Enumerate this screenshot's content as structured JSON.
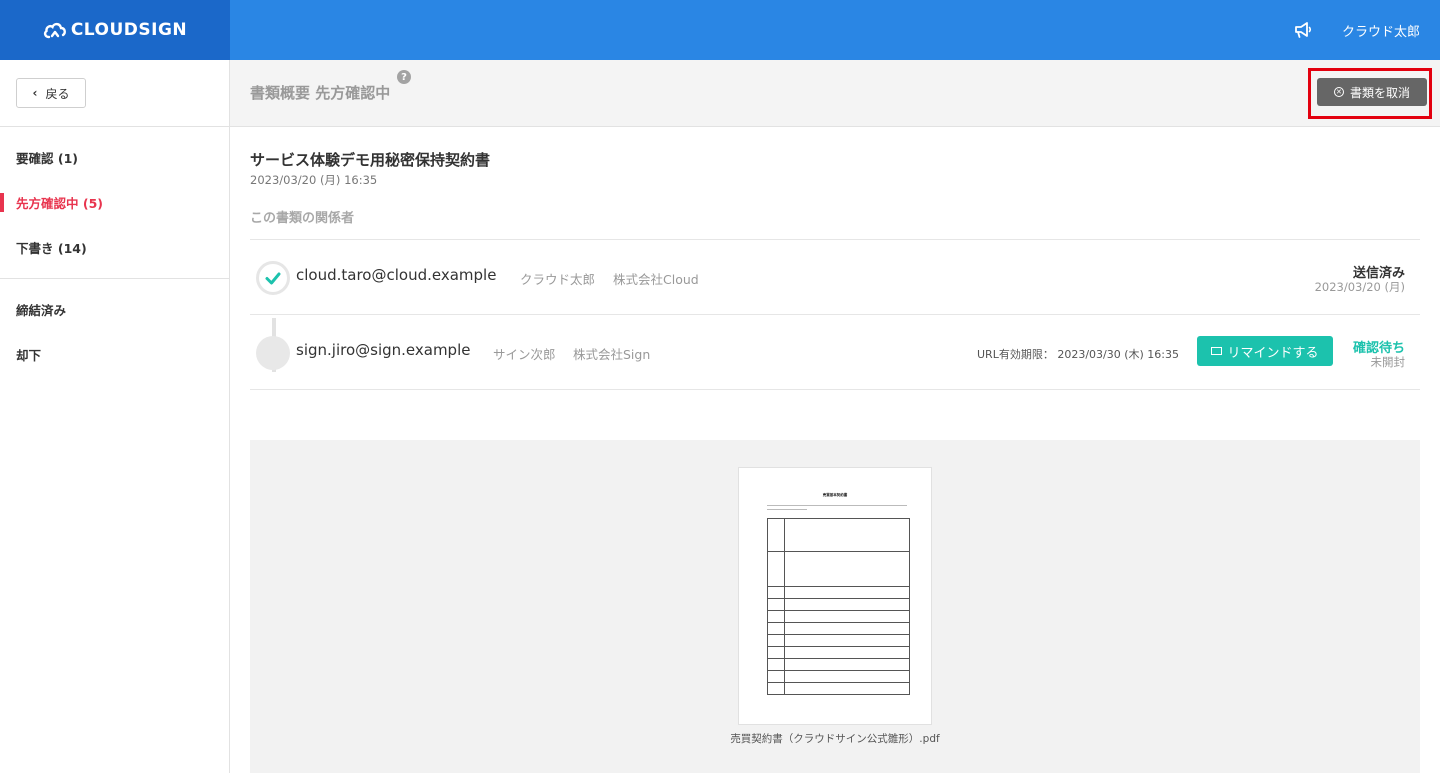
{
  "header": {
    "logo_text": "CLOUDSIGN",
    "logo_icon": "cloud-icon",
    "notification_icon": "megaphone-icon",
    "user_name": "クラウド太郎"
  },
  "sidebar": {
    "back_label": "戻る",
    "items": [
      {
        "label": "要確認 (1)",
        "active": false
      },
      {
        "label": "先方確認中 (5)",
        "active": true
      },
      {
        "label": "下書き (14)",
        "active": false
      },
      {
        "label": "締結済み",
        "active": false
      },
      {
        "label": "却下",
        "active": false
      }
    ]
  },
  "titlebar": {
    "title": "書類概要 先方確認中",
    "help_symbol": "?",
    "cancel_label": "書類を取消"
  },
  "document": {
    "title": "サービス体験デモ用秘密保持契約書",
    "date": "2023/03/20 (月) 16:35",
    "parties_label": "この書類の関係者"
  },
  "parties": [
    {
      "email": "cloud.taro@cloud.example",
      "name": "クラウド太郎",
      "company": "株式会社Cloud",
      "status": "送信済み",
      "status_sub": "2023/03/20 (月)",
      "status_color": "#333333"
    },
    {
      "email": "sign.jiro@sign.example",
      "name": "サイン次郎",
      "company": "株式会社Sign",
      "url_expiry": "URL有効期限： 2023/03/30 (木) 16:35",
      "remind_label": "リマインドする",
      "status": "確認待ち",
      "status_sub": "未開封",
      "status_color": "#1cc2ad"
    }
  ],
  "attachment": {
    "file_name": "売買契約書（クラウドサイン公式雛形）.pdf",
    "thumbnail_title": "売買基本契約書"
  },
  "colors": {
    "header_blue": "#2a86e4",
    "logo_blue": "#1b68c9",
    "active_red": "#e8344e",
    "teal": "#1cc2ad",
    "highlight_red": "#e3000f"
  }
}
